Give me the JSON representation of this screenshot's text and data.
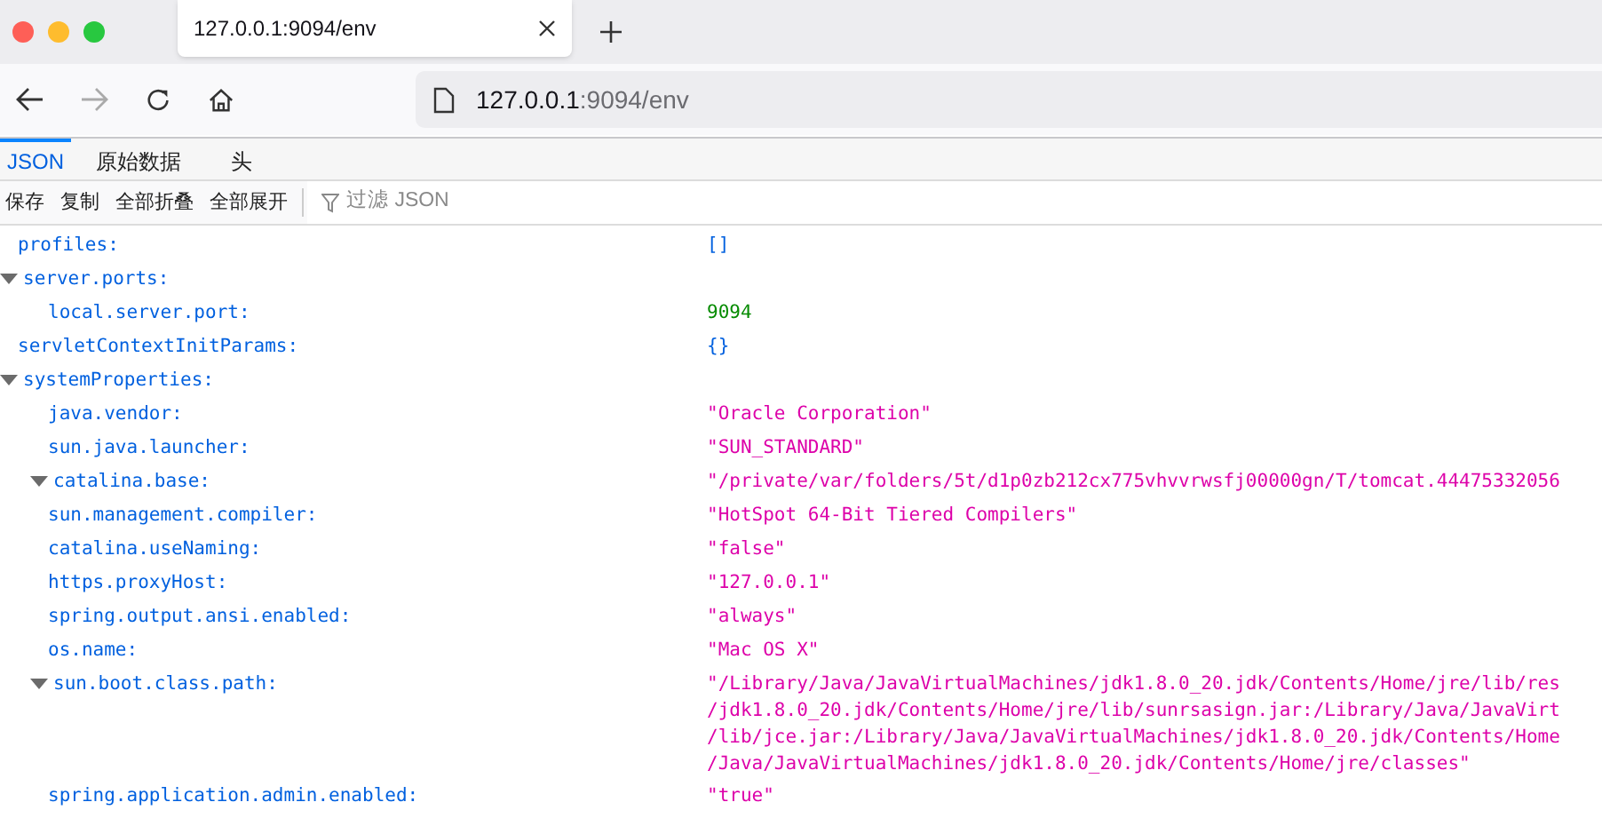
{
  "browser_tab": {
    "title": "127.0.0.1:9094/env"
  },
  "address_bar": {
    "host": "127.0.0.1",
    "path": ":9094/env"
  },
  "viewer_tabs": [
    {
      "label": "JSON",
      "selected": true
    },
    {
      "label": "原始数据",
      "selected": false
    },
    {
      "label": "头",
      "selected": false
    }
  ],
  "toolbar": {
    "buttons": [
      "保存",
      "复制",
      "全部折叠",
      "全部展开"
    ],
    "filter_placeholder": "过滤 JSON"
  },
  "tree": [
    {
      "key": "profiles:",
      "value": "[]",
      "kind": "empty"
    },
    {
      "key": "server.ports:",
      "expanded": true,
      "children": [
        {
          "key": "local.server.port:",
          "value": "9094",
          "kind": "number"
        }
      ]
    },
    {
      "key": "servletContextInitParams:",
      "value": "{}",
      "kind": "empty"
    },
    {
      "key": "systemProperties:",
      "expanded": true,
      "children": [
        {
          "key": "java.vendor:",
          "value": "\"Oracle Corporation\"",
          "kind": "string"
        },
        {
          "key": "sun.java.launcher:",
          "value": "\"SUN_STANDARD\"",
          "kind": "string"
        },
        {
          "key": "catalina.base:",
          "value": "\"/private/var/folders/5t/d1p0zb212cx775vhvvrwsfj00000gn/T/tomcat.44475332056",
          "kind": "string",
          "expanded": true
        },
        {
          "key": "sun.management.compiler:",
          "value": "\"HotSpot 64-Bit Tiered Compilers\"",
          "kind": "string"
        },
        {
          "key": "catalina.useNaming:",
          "value": "\"false\"",
          "kind": "string"
        },
        {
          "key": "https.proxyHost:",
          "value": "\"127.0.0.1\"",
          "kind": "string"
        },
        {
          "key": "spring.output.ansi.enabled:",
          "value": "\"always\"",
          "kind": "string"
        },
        {
          "key": "os.name:",
          "value": "\"Mac OS X\"",
          "kind": "string"
        },
        {
          "key": "sun.boot.class.path:",
          "kind": "string",
          "expanded": true,
          "value_lines": [
            "\"/Library/Java/JavaVirtualMachines/jdk1.8.0_20.jdk/Contents/Home/jre/lib/res",
            "/jdk1.8.0_20.jdk/Contents/Home/jre/lib/sunrsasign.jar:/Library/Java/JavaVirt",
            "/lib/jce.jar:/Library/Java/JavaVirtualMachines/jdk1.8.0_20.jdk/Contents/Home",
            "/Java/JavaVirtualMachines/jdk1.8.0_20.jdk/Contents/Home/jre/classes\""
          ]
        },
        {
          "key": "spring.application.admin.enabled:",
          "value": "\"true\"",
          "kind": "string"
        }
      ]
    }
  ]
}
